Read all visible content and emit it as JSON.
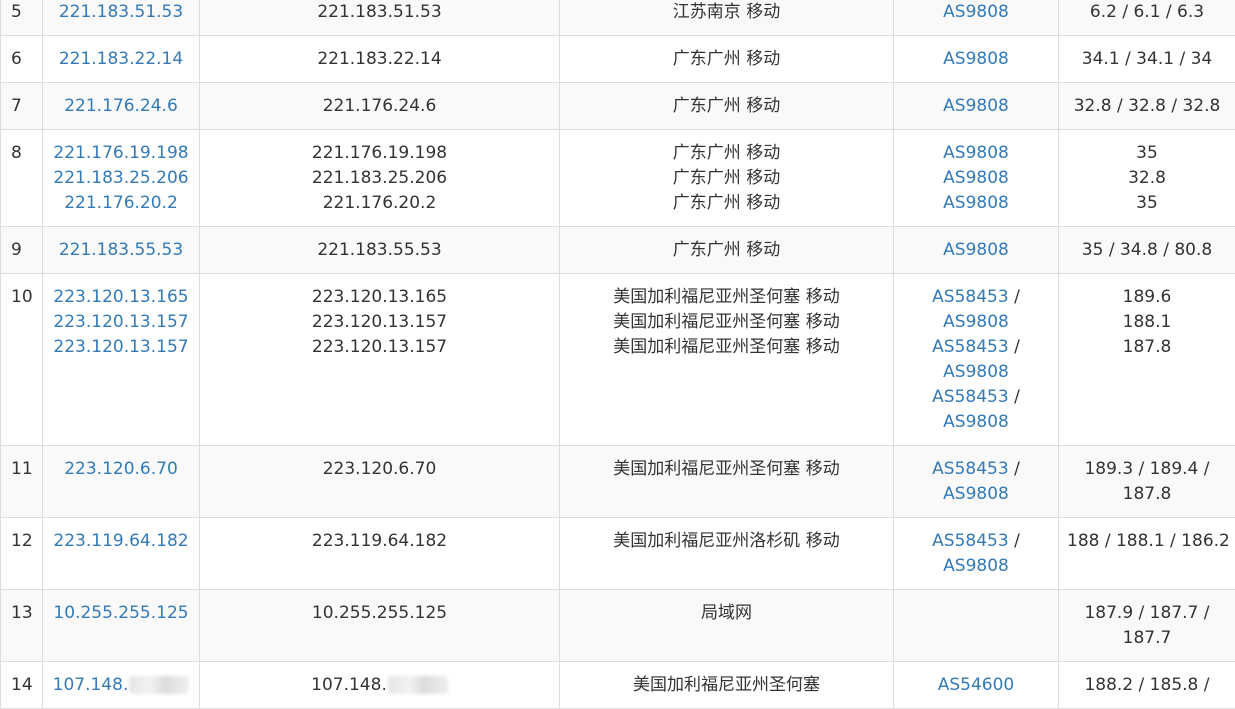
{
  "rows": [
    {
      "hop": "5",
      "ips": [
        "221.183.51.53"
      ],
      "hosts": [
        "221.183.51.53"
      ],
      "locations": [
        "江苏南京 移动"
      ],
      "asns": [
        [
          "AS9808"
        ]
      ],
      "times": [
        "6.2 / 6.1 / 6.3"
      ]
    },
    {
      "hop": "6",
      "ips": [
        "221.183.22.14"
      ],
      "hosts": [
        "221.183.22.14"
      ],
      "locations": [
        "广东广州 移动"
      ],
      "asns": [
        [
          "AS9808"
        ]
      ],
      "times": [
        "34.1 / 34.1 / 34"
      ]
    },
    {
      "hop": "7",
      "ips": [
        "221.176.24.6"
      ],
      "hosts": [
        "221.176.24.6"
      ],
      "locations": [
        "广东广州 移动"
      ],
      "asns": [
        [
          "AS9808"
        ]
      ],
      "times": [
        "32.8 / 32.8 / 32.8"
      ]
    },
    {
      "hop": "8",
      "ips": [
        "221.176.19.198",
        "221.183.25.206",
        "221.176.20.2"
      ],
      "hosts": [
        "221.176.19.198",
        "221.183.25.206",
        "221.176.20.2"
      ],
      "locations": [
        "广东广州 移动",
        "广东广州 移动",
        "广东广州 移动"
      ],
      "asns": [
        [
          "AS9808"
        ],
        [
          "AS9808"
        ],
        [
          "AS9808"
        ]
      ],
      "times": [
        "35",
        "32.8",
        "35"
      ]
    },
    {
      "hop": "9",
      "ips": [
        "221.183.55.53"
      ],
      "hosts": [
        "221.183.55.53"
      ],
      "locations": [
        "广东广州 移动"
      ],
      "asns": [
        [
          "AS9808"
        ]
      ],
      "times": [
        "35 / 34.8 / 80.8"
      ]
    },
    {
      "hop": "10",
      "ips": [
        "223.120.13.165",
        "223.120.13.157",
        "223.120.13.157"
      ],
      "hosts": [
        "223.120.13.165",
        "223.120.13.157",
        "223.120.13.157"
      ],
      "locations": [
        "美国加利福尼亚州圣何塞 移动",
        "美国加利福尼亚州圣何塞 移动",
        "美国加利福尼亚州圣何塞 移动"
      ],
      "asns": [
        [
          "AS58453",
          "AS9808"
        ],
        [
          "AS58453",
          "AS9808"
        ],
        [
          "AS58453",
          "AS9808"
        ]
      ],
      "times": [
        "189.6",
        "188.1",
        "187.8"
      ]
    },
    {
      "hop": "11",
      "ips": [
        "223.120.6.70"
      ],
      "hosts": [
        "223.120.6.70"
      ],
      "locations": [
        "美国加利福尼亚州圣何塞 移动"
      ],
      "asns": [
        [
          "AS58453",
          "AS9808"
        ]
      ],
      "times": [
        "189.3 / 189.4 /",
        "187.8"
      ]
    },
    {
      "hop": "12",
      "ips": [
        "223.119.64.182"
      ],
      "hosts": [
        "223.119.64.182"
      ],
      "locations": [
        "美国加利福尼亚州洛杉矶 移动"
      ],
      "asns": [
        [
          "AS58453",
          "AS9808"
        ]
      ],
      "times": [
        "188 / 188.1 / 186.2"
      ]
    },
    {
      "hop": "13",
      "ips": [
        "10.255.255.125"
      ],
      "hosts": [
        "10.255.255.125"
      ],
      "locations": [
        "局域网"
      ],
      "asns": [],
      "times": [
        "187.9 / 187.7 /",
        "187.7"
      ]
    },
    {
      "hop": "14",
      "ips": [
        "107.148."
      ],
      "ips_redacted": true,
      "hosts": [
        "107.148."
      ],
      "locations": [
        "美国加利福尼亚州圣何塞"
      ],
      "asns": [
        [
          "AS54600"
        ]
      ],
      "times": [
        "188.2 / 185.8 /"
      ]
    }
  ]
}
